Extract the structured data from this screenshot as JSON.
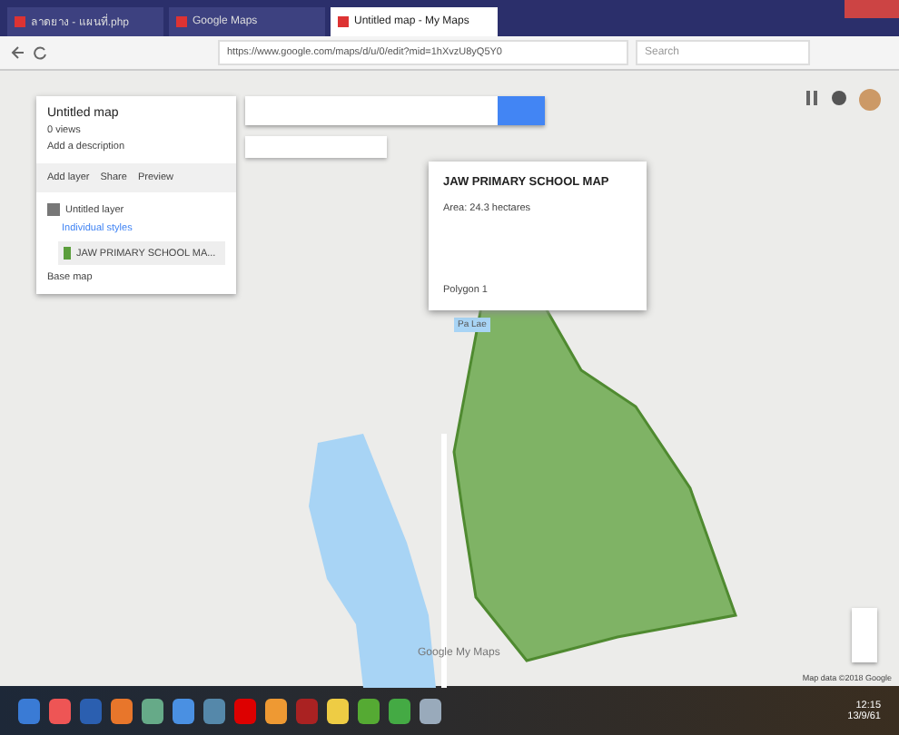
{
  "browser": {
    "tabs": [
      {
        "title": "ลาดยาง - แผนที่.php",
        "selected": false
      },
      {
        "title": "Google Maps",
        "selected": false
      },
      {
        "title": "Untitled map - My Maps",
        "selected": true
      }
    ],
    "address": "https://www.google.com/maps/d/u/0/edit?mid=1hXvzU8yQ5Y0",
    "search_placeholder": "Search"
  },
  "map_panel": {
    "title": "Untitled map",
    "views": "0 views",
    "description": "Add a description",
    "actions": [
      "Add layer",
      "Share",
      "Preview"
    ],
    "layers": [
      {
        "name": "Untitled layer",
        "checked": true,
        "style": "Individual styles",
        "items": [
          {
            "label": "JAW PRIMARY SCHOOL MA...",
            "selected": true,
            "color": "#5b9e3c"
          }
        ]
      }
    ],
    "base_map": "Base map"
  },
  "popup": {
    "title": "JAW PRIMARY SCHOOL MAP",
    "description": "Area: 24.3 hectares",
    "footer": "Polygon 1"
  },
  "map_label": "Pa Lae",
  "logo": "Google My Maps",
  "attribution": "Map data ©2018 Google",
  "clock": {
    "time": "12:15",
    "date": "13/9/61"
  }
}
